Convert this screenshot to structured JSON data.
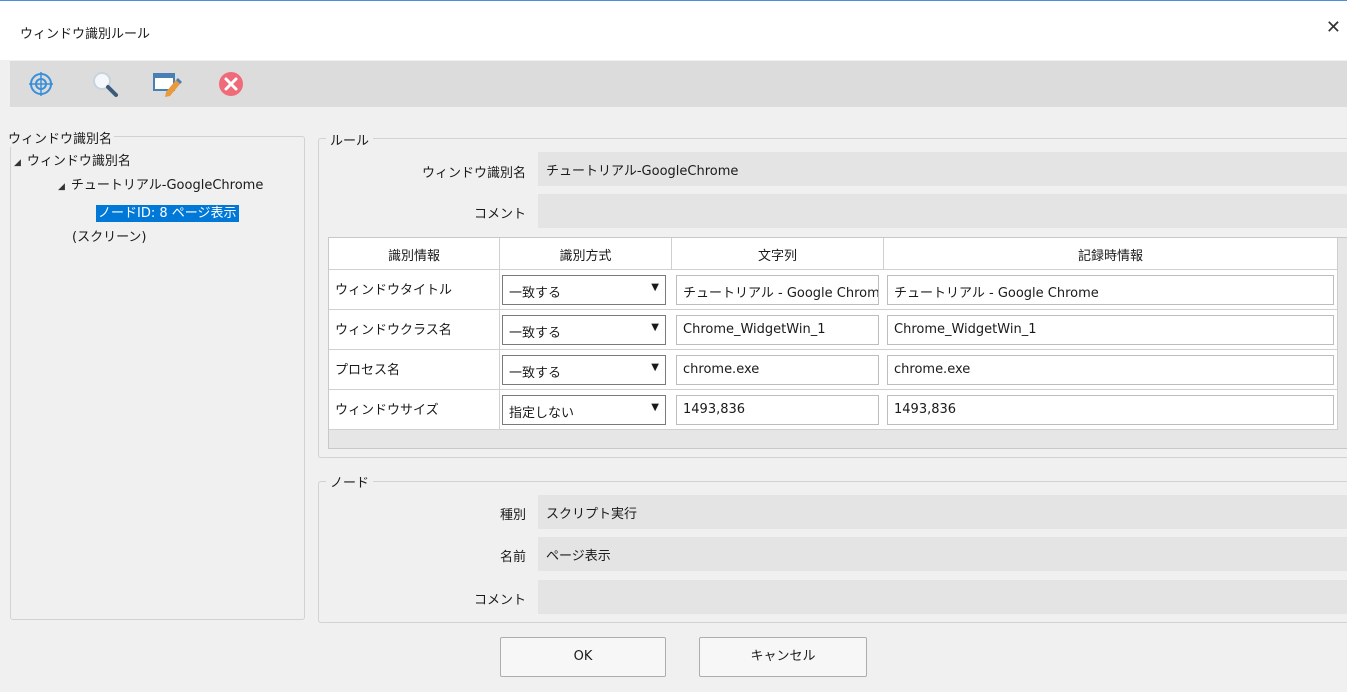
{
  "window": {
    "title": "ウィンドウ識別ルール",
    "close": "✕"
  },
  "toolbar": {
    "buttons": [
      {
        "icon": "target-icon",
        "tooltip": ""
      },
      {
        "icon": "magnifier-icon",
        "tooltip": ""
      },
      {
        "icon": "edit-window-icon",
        "tooltip": ""
      },
      {
        "icon": "delete-icon",
        "tooltip": ""
      }
    ]
  },
  "tree": {
    "legend": "ウィンドウ識別名",
    "items": [
      {
        "label": "ウィンドウ識別名"
      },
      {
        "label": "チュートリアル-GoogleChrome"
      },
      {
        "label": "ノードID: 8 ページ表示"
      },
      {
        "label": "(スクリーン)"
      }
    ]
  },
  "rule": {
    "legend": "ルール",
    "name_label": "ウィンドウ識別名",
    "name_value": "チュートリアル-GoogleChrome",
    "comment_label": "コメント",
    "comment_value": "",
    "columns": [
      "識別情報",
      "識別方式",
      "文字列",
      "記録時情報"
    ],
    "rows": [
      {
        "label": "ウィンドウタイトル",
        "method": "一致する",
        "text": "チュートリアル - Google Chrome",
        "recorded": "チュートリアル - Google Chrome"
      },
      {
        "label": "ウィンドウクラス名",
        "method": "一致する",
        "text": "Chrome_WidgetWin_1",
        "recorded": "Chrome_WidgetWin_1"
      },
      {
        "label": "プロセス名",
        "method": "一致する",
        "text": "chrome.exe",
        "recorded": "chrome.exe"
      },
      {
        "label": "ウィンドウサイズ",
        "method": "指定しない",
        "text": "1493,836",
        "recorded": "1493,836"
      }
    ]
  },
  "node": {
    "legend": "ノード",
    "type_label": "種別",
    "type_value": "スクリプト実行",
    "name_label": "名前",
    "name_value": "ページ表示",
    "comment_label": "コメント",
    "comment_value": ""
  },
  "buttons": {
    "ok": "OK",
    "cancel": "キャンセル"
  },
  "colors": {
    "selection": "#0078d7",
    "toolbar": "#dcdcdc",
    "target_icon": "#3a8fd8",
    "delete_icon": "#f06b7a"
  }
}
